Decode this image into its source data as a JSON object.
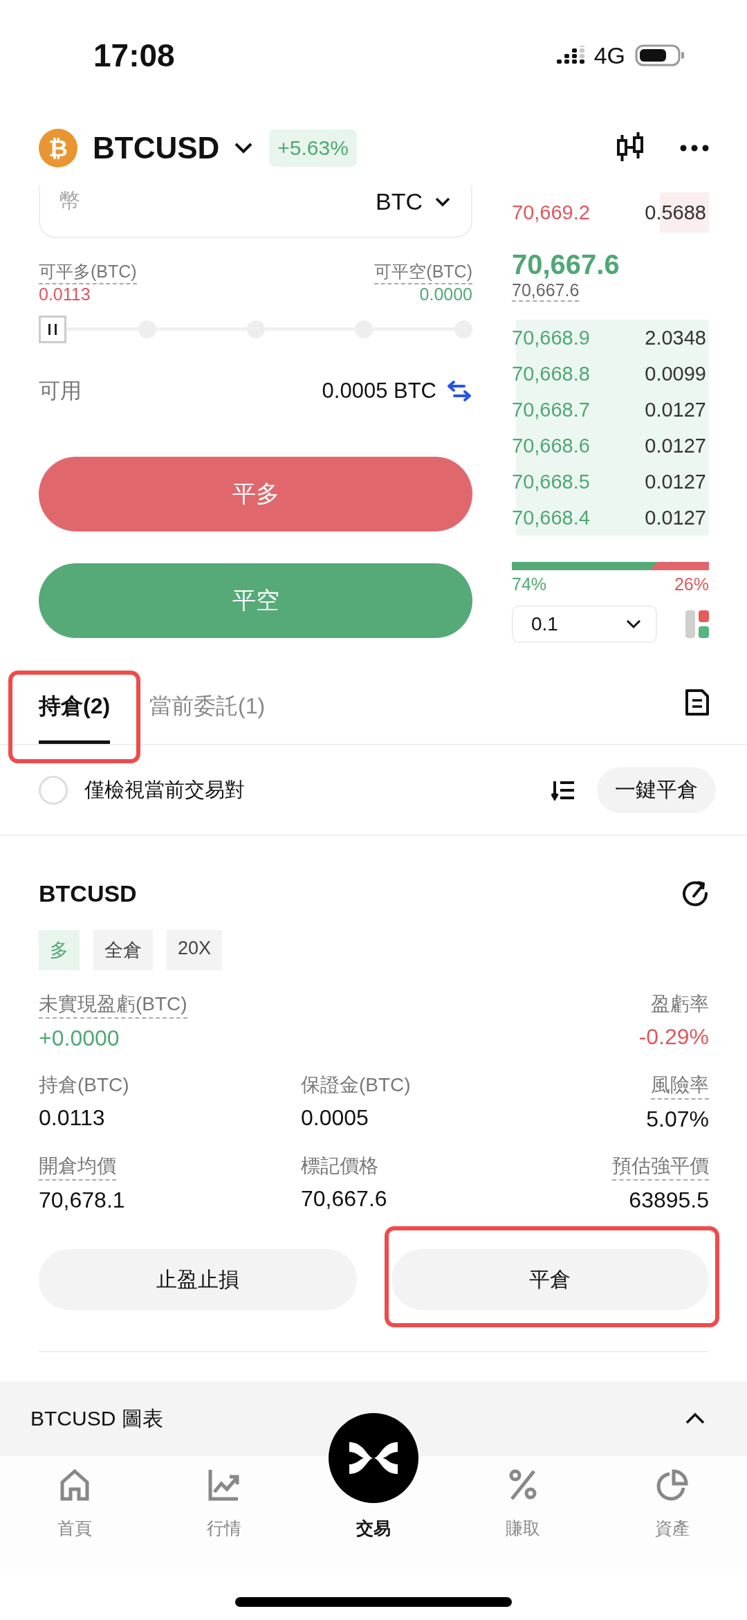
{
  "status_bar": {
    "time": "17:08",
    "network": "4G"
  },
  "header": {
    "coin_symbol": "₿",
    "pair": "BTCUSD",
    "change": "+5.63%"
  },
  "order_form": {
    "unit_label": "幣",
    "unit": "BTC",
    "close_long_label": "可平多(BTC)",
    "close_long_value": "0.0113",
    "close_short_label": "可平空(BTC)",
    "close_short_value": "0.0000",
    "slider": {
      "level": 0
    },
    "available_label": "可用",
    "available_value": "0.0005 BTC",
    "buttons": [
      {
        "label": "平多",
        "kind": "sell"
      },
      {
        "label": "平空",
        "kind": "buy"
      }
    ]
  },
  "order_book": {
    "asks": [
      {
        "price": "70,669.2",
        "amount": "0.5688"
      }
    ],
    "last_price": "70,667.6",
    "mark_price": "70,667.6",
    "bids": [
      {
        "price": "70,668.9",
        "amount": "2.0348"
      },
      {
        "price": "70,668.8",
        "amount": "0.0099"
      },
      {
        "price": "70,668.7",
        "amount": "0.0127"
      },
      {
        "price": "70,668.6",
        "amount": "0.0127"
      },
      {
        "price": "70,668.5",
        "amount": "0.0127"
      },
      {
        "price": "70,668.4",
        "amount": "0.0127"
      }
    ],
    "ratio": {
      "level": 0.74,
      "buy": "74%",
      "sell": "26%"
    },
    "tick_size": "0.1"
  },
  "tabs": [
    {
      "label": "持倉(2)",
      "selected": true,
      "highlighted": true
    },
    {
      "label": "當前委託(1)",
      "selected": false,
      "highlighted": false
    }
  ],
  "filter": {
    "label": "僅檢視當前交易對",
    "checked": false,
    "close_all": "一鍵平倉"
  },
  "position": {
    "symbol": "BTCUSD",
    "tags": [
      {
        "label": "多",
        "kind": "long"
      },
      {
        "label": "全倉",
        "kind": "plain"
      },
      {
        "label": "20X",
        "kind": "plain"
      }
    ],
    "stats": [
      [
        {
          "label": "未實現盈虧(BTC)",
          "value": "+0.0000",
          "dotted": true,
          "color": "#4fa874"
        },
        {
          "label": "盈虧率",
          "value": "-0.29%",
          "dotted": false,
          "color": "#e0575e"
        }
      ],
      [
        {
          "label": "持倉(BTC)",
          "value": "0.0113",
          "dotted": false,
          "color": "#111111"
        },
        {
          "label": "保證金(BTC)",
          "value": "0.0005",
          "dotted": false,
          "color": "#111111"
        },
        {
          "label": "風險率",
          "value": "5.07%",
          "dotted": true,
          "color": "#111111"
        }
      ],
      [
        {
          "label": "開倉均價",
          "value": "70,678.1",
          "dotted": true,
          "color": "#111111"
        },
        {
          "label": "標記價格",
          "value": "70,667.6",
          "dotted": false,
          "color": "#111111"
        },
        {
          "label": "預估強平價",
          "value": "63895.5",
          "dotted": true,
          "color": "#111111"
        }
      ]
    ],
    "actions": [
      {
        "label": "止盈止損",
        "highlighted": false
      },
      {
        "label": "平倉",
        "highlighted": true
      }
    ]
  },
  "chart_bar": {
    "label": "BTCUSD 圖表"
  },
  "nav": [
    {
      "label": "首頁",
      "kind": "home",
      "selected": false
    },
    {
      "label": "行情",
      "kind": "market",
      "selected": false
    },
    {
      "label": "交易",
      "kind": "trade",
      "selected": true
    },
    {
      "label": "賺取",
      "kind": "earn",
      "selected": false
    },
    {
      "label": "資產",
      "kind": "assets",
      "selected": false
    }
  ]
}
